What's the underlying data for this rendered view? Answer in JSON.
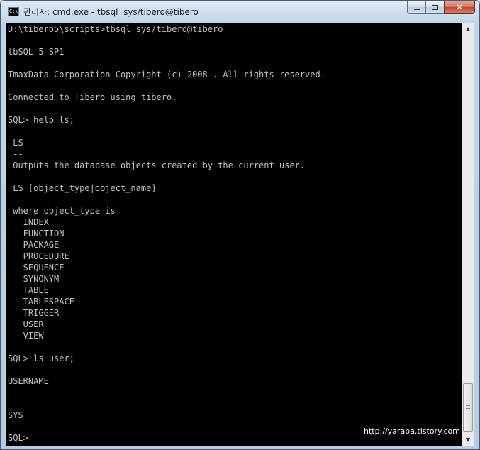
{
  "window": {
    "title": "관리자: cmd.exe - tbsql  sys/tibero@tibero",
    "icon": "cmd-icon",
    "buttons": {
      "minimize": "minimize-icon",
      "maximize": "maximize-icon",
      "close": "close-icon"
    }
  },
  "console": {
    "lines": [
      "D:\\tibero5\\scripts>tbsql sys/tibero@tibero",
      "",
      "tbSQL 5 SP1",
      "",
      "TmaxData Corporation Copyright (c) 2008-. All rights reserved.",
      "",
      "Connected to Tibero using tibero.",
      "",
      "SQL> help ls;",
      "",
      " LS",
      " --",
      " Outputs the database objects created by the current user.",
      "",
      " LS [object_type|object_name]",
      "",
      " where object_type is",
      "   INDEX",
      "   FUNCTION",
      "   PACKAGE",
      "   PROCEDURE",
      "   SEQUENCE",
      "   SYNONYM",
      "   TABLE",
      "   TABLESPACE",
      "   TRIGGER",
      "   USER",
      "   VIEW",
      "",
      "SQL> ls user;",
      "",
      "USERNAME",
      "--------------------------------------------------------------------------------",
      "",
      "SYS",
      "",
      "SQL>"
    ],
    "watermark": "http://yaraba.tistory.com"
  },
  "scrollbar": {
    "up_icon": "scroll-up-arrow-icon",
    "down_icon": "scroll-down-arrow-icon"
  },
  "colors": {
    "console_bg": "#000000",
    "console_fg": "#c0c0c0",
    "close_button": "#c0452c"
  }
}
